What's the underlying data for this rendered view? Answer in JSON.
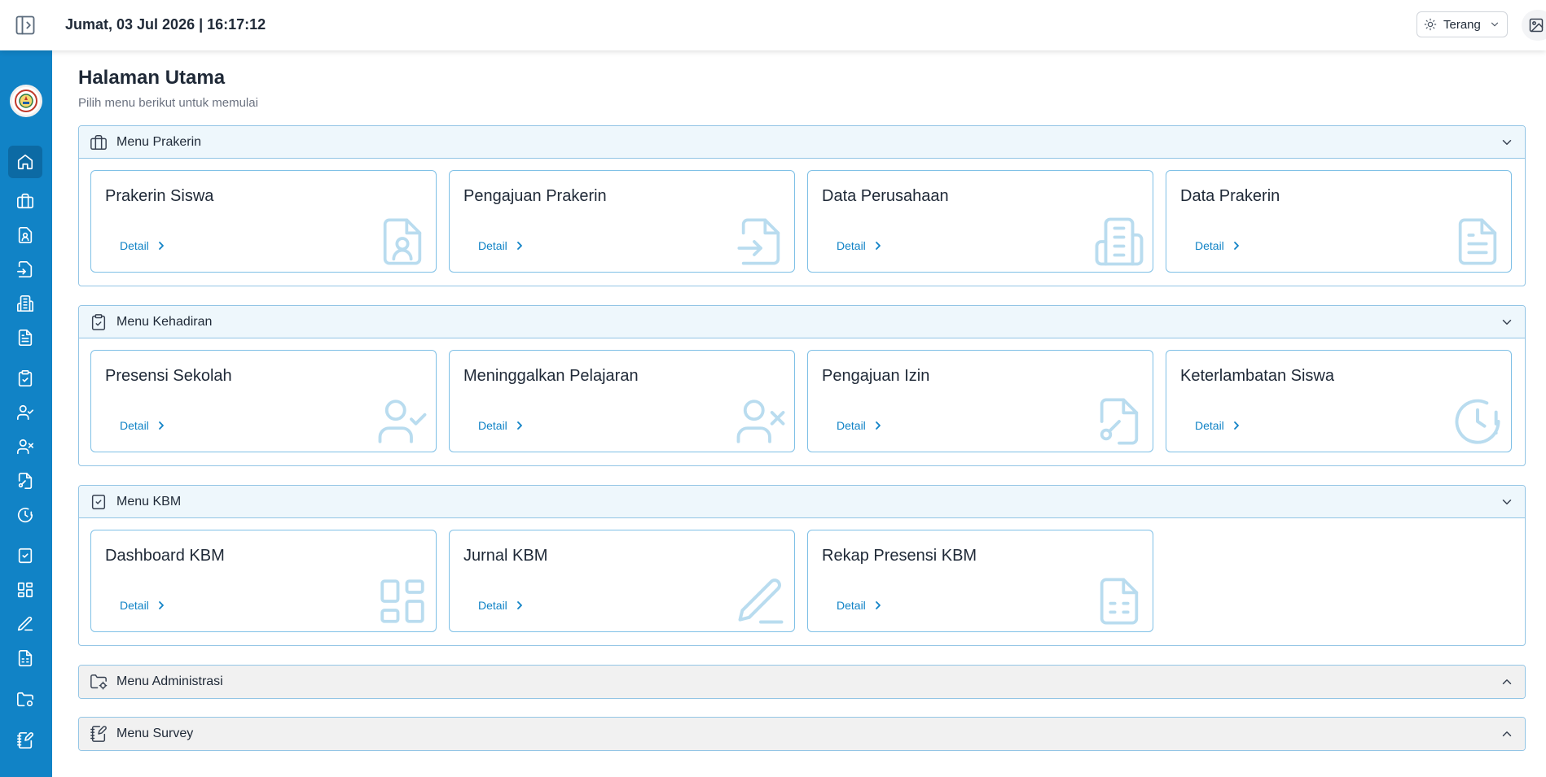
{
  "topbar": {
    "datetime": "Jumat, 03 Jul 2026 | 16:17:12",
    "theme_label": "Terang"
  },
  "page": {
    "title": "Halaman Utama",
    "subtitle": "Pilih menu berikut untuk memulai"
  },
  "sections": [
    {
      "title": "Menu Prakerin",
      "icon": "briefcase-icon",
      "collapsed": false,
      "cards": [
        {
          "title": "Prakerin Siswa",
          "detail": "Detail",
          "icon": "file-user-icon"
        },
        {
          "title": "Pengajuan Prakerin",
          "detail": "Detail",
          "icon": "file-input-icon"
        },
        {
          "title": "Data Perusahaan",
          "detail": "Detail",
          "icon": "building-icon"
        },
        {
          "title": "Data Prakerin",
          "detail": "Detail",
          "icon": "file-text-icon"
        }
      ]
    },
    {
      "title": "Menu Kehadiran",
      "icon": "clipboard-check-icon",
      "collapsed": false,
      "cards": [
        {
          "title": "Presensi Sekolah",
          "detail": "Detail",
          "icon": "user-check-icon"
        },
        {
          "title": "Meninggalkan Pelajaran",
          "detail": "Detail",
          "icon": "user-x-icon"
        },
        {
          "title": "Pengajuan Izin",
          "detail": "Detail",
          "icon": "file-signature-icon"
        },
        {
          "title": "Keterlambatan Siswa",
          "detail": "Detail",
          "icon": "clock-alert-icon"
        }
      ]
    },
    {
      "title": "Menu KBM",
      "icon": "square-check-icon",
      "collapsed": false,
      "cards": [
        {
          "title": "Dashboard KBM",
          "detail": "Detail",
          "icon": "layout-dashboard-icon"
        },
        {
          "title": "Jurnal KBM",
          "detail": "Detail",
          "icon": "pencil-line-icon"
        },
        {
          "title": "Rekap Presensi KBM",
          "detail": "Detail",
          "icon": "file-spreadsheet-icon"
        }
      ]
    },
    {
      "title": "Menu Administrasi",
      "icon": "folder-cog-icon",
      "collapsed": true,
      "cards": []
    },
    {
      "title": "Menu Survey",
      "icon": "notebook-pen-icon",
      "collapsed": true,
      "cards": []
    }
  ],
  "colors": {
    "sidebar": "#1183c6",
    "accent": "#1183c6",
    "card_border": "#7fc0e6",
    "card_icon": "#b9dcef"
  }
}
